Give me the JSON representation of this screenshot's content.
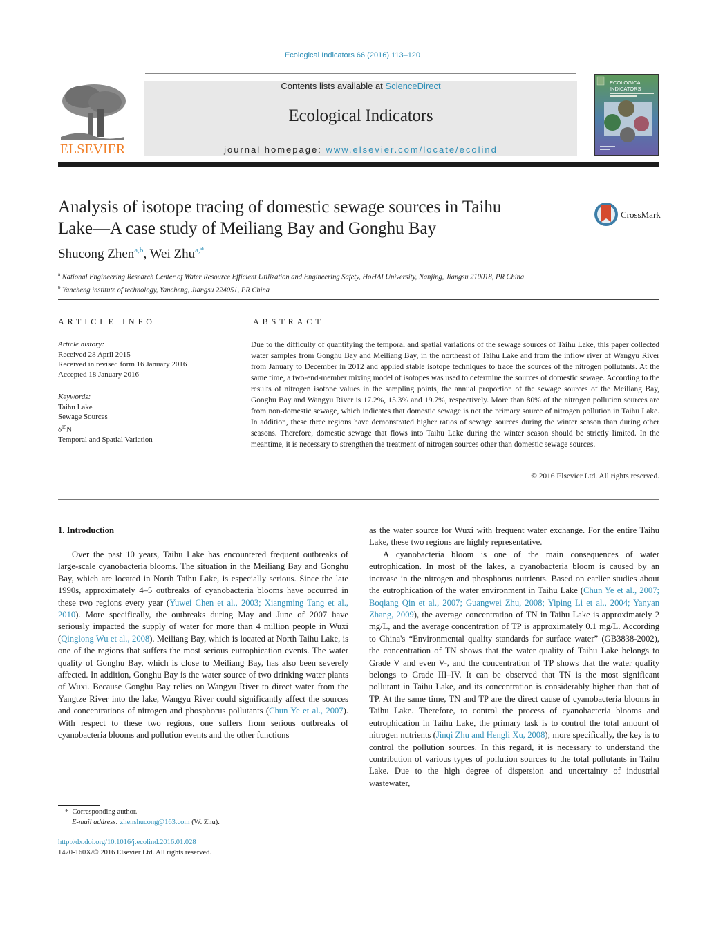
{
  "header": {
    "journal_ref": "Ecological Indicators 66 (2016) 113–120",
    "contents_prefix": "Contents lists available at ",
    "contents_link": "ScienceDirect",
    "journal_title": "Ecological Indicators",
    "homepage_prefix": "journal homepage: ",
    "homepage_link": "www.elsevier.com/locate/ecolind",
    "publisher_logo_text": "ELSEVIER",
    "cover_title_line1": "ECOLOGICAL",
    "cover_title_line2": "INDICATORS",
    "colors": {
      "link": "#2f8fb7",
      "elsevier_orange": "#f07e26",
      "masthead_bg": "#e8e8e8"
    }
  },
  "article": {
    "title_line1": "Analysis of isotope tracing of domestic sewage sources in Taihu",
    "title_line2": "Lake—A case study of Meiliang Bay and Gonghu Bay",
    "crossmark_label": "CrossMark",
    "authors": [
      {
        "name": "Shucong Zhen",
        "sup": "a,b"
      },
      {
        "name": "Wei Zhu",
        "sup": "a,*"
      }
    ],
    "affiliations": [
      {
        "mark": "a",
        "text": "National Engineering Research Center of Water Resource Efficient Utilization and Engineering Safety, HoHAI University, Nanjing, Jiangsu 210018, PR China"
      },
      {
        "mark": "b",
        "text": "Yancheng institute of technology, Yancheng, Jiangsu 224051, PR China"
      }
    ]
  },
  "article_info": {
    "heading": "ARTICLE INFO",
    "history_label": "Article history:",
    "history": [
      "Received 28 April 2015",
      "Received in revised form 16 January 2016",
      "Accepted 18 January 2016"
    ],
    "keywords_label": "Keywords:",
    "keywords": [
      "Taihu Lake",
      "Sewage Sources",
      "δ15N",
      "Temporal and Spatial Variation"
    ]
  },
  "abstract": {
    "heading": "ABSTRACT",
    "text": "Due to the difficulty of quantifying the temporal and spatial variations of the sewage sources of Taihu Lake, this paper collected water samples from Gonghu Bay and Meiliang Bay, in the northeast of Taihu Lake and from the inflow river of Wangyu River from January to December in 2012 and applied stable isotope techniques to trace the sources of the nitrogen pollutants. At the same time, a two-end-member mixing model of isotopes was used to determine the sources of domestic sewage. According to the results of nitrogen isotope values in the sampling points, the annual proportion of the sewage sources of the Meiliang Bay, Gonghu Bay and Wangyu River is 17.2%, 15.3% and 19.7%, respectively. More than 80% of the nitrogen pollution sources are from non-domestic sewage, which indicates that domestic sewage is not the primary source of nitrogen pollution in Taihu Lake. In addition, these three regions have demonstrated higher ratios of sewage sources during the winter season than during other seasons. Therefore, domestic sewage that flows into Taihu Lake during the winter season should be strictly limited. In the meantime, it is necessary to strengthen the treatment of nitrogen sources other than domestic sewage sources.",
    "copyright": "© 2016 Elsevier Ltd. All rights reserved."
  },
  "body": {
    "section_heading": "1.  Introduction",
    "left_col": {
      "t1": "Over the past 10 years, Taihu Lake has encountered frequent outbreaks of large-scale cyanobacteria blooms. The situation in the Meiliang Bay and Gonghu Bay, which are located in North Taihu Lake, is especially serious. Since the late 1990s, approximately 4–5 outbreaks of cyanobacteria blooms have occurred in these two regions every year (",
      "c1": "Yuwei Chen et al., 2003; Xiangming Tang et al., 2010",
      "t2": "). More specifically, the outbreaks during May and June of 2007 have seriously impacted the supply of water for more than 4 million people in Wuxi (",
      "c2": "Qinglong Wu et al., 2008",
      "t3": "). Meiliang Bay, which is located at North Taihu Lake, is one of the regions that suffers the most serious eutrophication events. The water quality of Gonghu Bay, which is close to Meiliang Bay, has also been severely affected. In addition, Gonghu Bay is the water source of two drinking water plants of Wuxi. Because Gonghu Bay relies on Wangyu River to direct water from the Yangtze River into the lake, Wangyu River could significantly affect the sources and concentrations of nitrogen and phosphorus pollutants (",
      "c3": "Chun Ye et al., 2007",
      "t4": "). With respect to these two regions, one suffers from serious outbreaks of cyanobacteria blooms and pollution events and the other functions"
    },
    "right_col_a": "as the water source for Wuxi with frequent water exchange. For the entire Taihu Lake, these two regions are highly representative.",
    "right_col_b": {
      "t1": "A cyanobacteria bloom is one of the main consequences of water eutrophication. In most of the lakes, a cyanobacteria bloom is caused by an increase in the nitrogen and phosphorus nutrients. Based on earlier studies about the eutrophication of the water environment in Taihu Lake (",
      "c1": "Chun Ye et al., 2007; Boqiang Qin et al., 2007; Guangwei Zhu, 2008; Yiping Li et al., 2004; Yanyan Zhang, 2009",
      "t2": "), the average concentration of TN in Taihu Lake is approximately 2 mg/L, and the average concentration of TP is approximately 0.1 mg/L. According to China's “Environmental quality standards for surface water” (GB3838-2002), the concentration of TN shows that the water quality of Taihu Lake belongs to Grade V and even V-, and the concentration of TP shows that the water quality belongs to Grade III–IV. It can be observed that TN is the most significant pollutant in Taihu Lake, and its concentration is considerably higher than that of TP. At the same time, TN and TP are the direct cause of cyanobacteria blooms in Taihu Lake. Therefore, to control the process of cyanobacteria blooms and eutrophication in Taihu Lake, the primary task is to control the total amount of nitrogen nutrients (",
      "c2": "Jinqi Zhu and Hengli Xu, 2008",
      "t3": "); more specifically, the key is to control the pollution sources. In this regard, it is necessary to understand the contribution of various types of pollution sources to the total pollutants in Taihu Lake. Due to the high degree of dispersion and uncertainty of industrial wastewater,"
    }
  },
  "footnotes": {
    "corresponding_mark": "*",
    "corresponding": "Corresponding author.",
    "email_label": "E-mail address:",
    "email": "zhenshucong@163.com",
    "email_suffix": " (W. Zhu).",
    "doi_link": "http://dx.doi.org/10.1016/j.ecolind.2016.01.028",
    "issn_line": "1470-160X/© 2016 Elsevier Ltd. All rights reserved."
  }
}
